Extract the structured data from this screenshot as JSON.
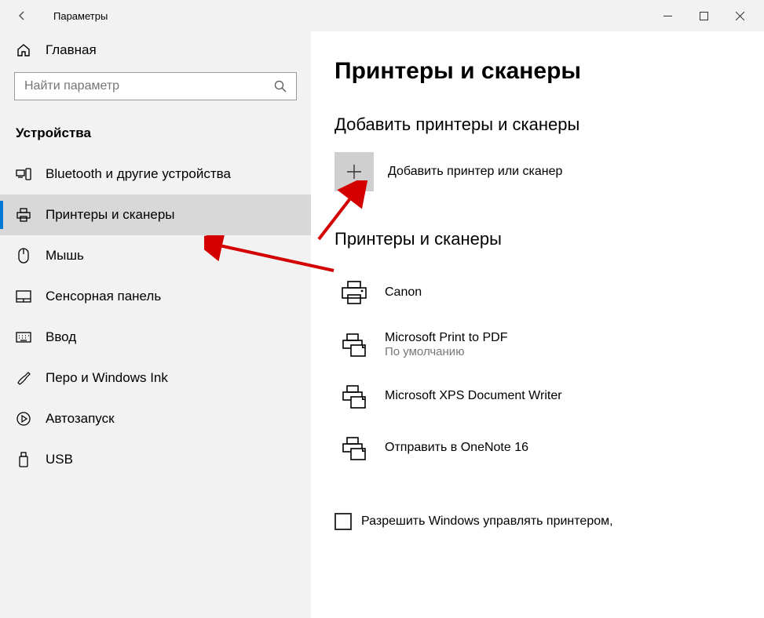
{
  "titlebar": {
    "title": "Параметры"
  },
  "sidebar": {
    "home": "Главная",
    "search_placeholder": "Найти параметр",
    "category": "Устройства",
    "items": [
      {
        "label": "Bluetooth и другие устройства"
      },
      {
        "label": "Принтеры и сканеры"
      },
      {
        "label": "Мышь"
      },
      {
        "label": "Сенсорная панель"
      },
      {
        "label": "Ввод"
      },
      {
        "label": "Перо и Windows Ink"
      },
      {
        "label": "Автозапуск"
      },
      {
        "label": "USB"
      }
    ]
  },
  "main": {
    "page_title": "Принтеры и сканеры",
    "add_section_header": "Добавить принтеры и сканеры",
    "add_label": "Добавить принтер или сканер",
    "list_header": "Принтеры и сканеры",
    "printers": [
      {
        "name": "Canon",
        "sub": ""
      },
      {
        "name": "Microsoft Print to PDF",
        "sub": "По умолчанию"
      },
      {
        "name": "Microsoft XPS Document Writer",
        "sub": ""
      },
      {
        "name": "Отправить в OneNote 16",
        "sub": ""
      }
    ],
    "checkbox_label": "Разрешить Windows управлять принтером,"
  }
}
